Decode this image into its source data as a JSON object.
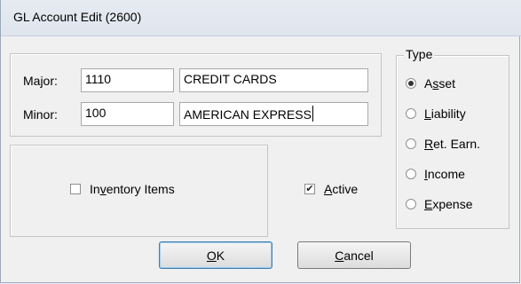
{
  "window": {
    "title": "GL Account Edit (2600)"
  },
  "fields": {
    "major_label": "Major:",
    "major_code": "1110",
    "major_name": "CREDIT CARDS",
    "minor_label": "Minor:",
    "minor_code": "100",
    "minor_name": "AMERICAN EXPRESS"
  },
  "checkboxes": {
    "inventory": {
      "label_pre": "In",
      "label_u": "v",
      "label_post": "entory Items",
      "checked": false
    },
    "active": {
      "label_pre": "",
      "label_u": "A",
      "label_post": "ctive",
      "checked": true
    }
  },
  "type_group": {
    "title": "Type",
    "options": [
      {
        "pre": "A",
        "u": "s",
        "post": "set",
        "selected": true
      },
      {
        "pre": "",
        "u": "L",
        "post": "iability",
        "selected": false
      },
      {
        "pre": "",
        "u": "R",
        "post": "et. Earn.",
        "selected": false
      },
      {
        "pre": "",
        "u": "I",
        "post": "ncome",
        "selected": false
      },
      {
        "pre": "",
        "u": "E",
        "post": "xpense",
        "selected": false
      }
    ]
  },
  "buttons": {
    "ok": {
      "u": "O",
      "post": "K"
    },
    "cancel": {
      "u": "C",
      "post": "ancel"
    }
  }
}
